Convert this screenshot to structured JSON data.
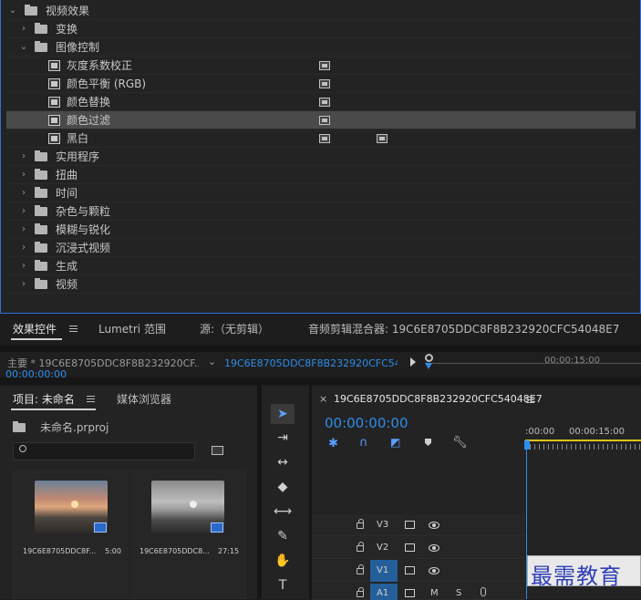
{
  "effects_tree": {
    "root": "视频效果",
    "items": [
      {
        "label": "变换"
      },
      {
        "label": "图像控制"
      },
      {
        "label": "灰度系数校正"
      },
      {
        "label": "颜色平衡 (RGB)"
      },
      {
        "label": "颜色替换"
      },
      {
        "label": "颜色过滤"
      },
      {
        "label": "黑白"
      },
      {
        "label": "实用程序"
      },
      {
        "label": "扭曲"
      },
      {
        "label": "时间"
      },
      {
        "label": "杂色与颗粒"
      },
      {
        "label": "模糊与锐化"
      },
      {
        "label": "沉浸式视频"
      },
      {
        "label": "生成"
      },
      {
        "label": "视频"
      }
    ]
  },
  "tabs": {
    "effect_controls": "效果控件",
    "lumetri": "Lumetri 范围",
    "source": "源:（无剪辑）",
    "audio_mixer": "音频剪辑混合器: 19C6E8705DDC8F8B232920CFC54048E7"
  },
  "clip_row": {
    "master": "主要 * 19C6E8705DDC8F8B232920CF...",
    "sequence": "19C6E8705DDC8F8B232920CFC540...",
    "timecode": "00:00:00:00",
    "ruler_mark": "00:00:15:00"
  },
  "project": {
    "tab_label": "项目: 未命名",
    "media_browser": "媒体浏览器",
    "project_file": "未命名.prproj",
    "items": [
      {
        "name": "19C6E8705DDC8F...",
        "duration": "5:00"
      },
      {
        "name": "19C6E8705DDC8...",
        "duration": "27:15"
      }
    ]
  },
  "timeline": {
    "sequence_name": "19C6E8705DDC8F8B232920CFC54048E7",
    "timecode": "00:00:00:00",
    "ruler_start": ":00:00",
    "ruler_mark": "00:00:15:00",
    "tracks": [
      "V3",
      "V2",
      "V1",
      "A1"
    ],
    "track_letters": [
      "M",
      "S"
    ]
  },
  "watermark": "最需教育",
  "colors": {
    "accent_blue": "#2d8ceb",
    "panel_bg": "#232323",
    "selection": "#4a4a4a",
    "playhead": "#2d8ceb",
    "work_area": "#e0c21a"
  }
}
